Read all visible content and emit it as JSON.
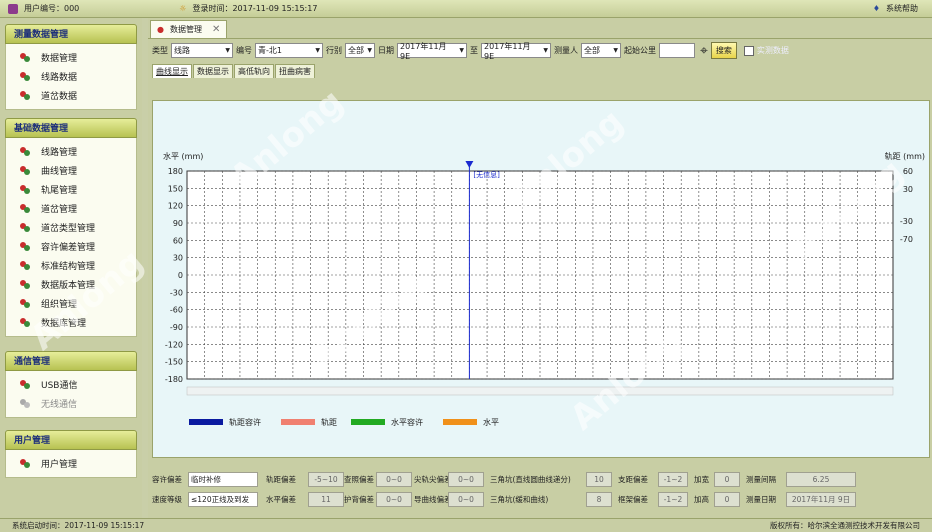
{
  "topbar": {
    "user_label": "用户编号：000",
    "login_label": "登录时间：2017-11-09 15:15:17",
    "help": "系统帮助"
  },
  "sidebar": {
    "groups": [
      {
        "title": "测量数据管理",
        "items": [
          "数据管理",
          "线路数据",
          "道岔数据"
        ]
      },
      {
        "title": "基础数据管理",
        "items": [
          "线路管理",
          "曲线管理",
          "轨尾管理",
          "道岔管理",
          "道岔类型管理",
          "容许偏差管理",
          "标准结构管理",
          "数据版本管理",
          "组织管理",
          "数据库管理"
        ]
      },
      {
        "title": "通信管理",
        "items": [
          "USB通信",
          "无线通信"
        ]
      },
      {
        "title": "用户管理",
        "items": [
          "用户管理"
        ]
      }
    ]
  },
  "main": {
    "tab_label": "数据管理",
    "filter": {
      "type_label": "类型",
      "type_value": "线路",
      "code_label": "编号",
      "code_value": "青-北1",
      "dir_label": "行别",
      "dir_value": "全部",
      "date_label": "日期",
      "date_from": "2017年11月 9E",
      "to_label": "至",
      "date_to": "2017年11月 9E",
      "person_label": "测量人",
      "person_value": "全部",
      "km_label": "起始公里",
      "search": "搜索",
      "realtime": "实测数据"
    },
    "subtabs": [
      "曲线显示",
      "数据显示",
      "高低轨向",
      "扭曲病害"
    ]
  },
  "chart_data": {
    "type": "line",
    "ylabel": "水平 (mm)",
    "y2label": "轨距 (mm)",
    "ylim": [
      -180,
      180
    ],
    "y_ticks": [
      180,
      150,
      120,
      90,
      60,
      30,
      0,
      -30,
      -60,
      -90,
      -120,
      -150,
      -180
    ],
    "y2_ticks": [
      "60",
      "30",
      "-30",
      "-70"
    ],
    "marker_label": "[无信息]",
    "legend": [
      {
        "name": "轨距容许",
        "color": "#0a1aa0"
      },
      {
        "name": "轨距",
        "color": "#f08070"
      },
      {
        "name": "水平容许",
        "color": "#22aa22"
      },
      {
        "name": "水平",
        "color": "#f0901a"
      }
    ]
  },
  "params": {
    "row1": [
      {
        "label": "容许偏差",
        "value": "临时补修"
      },
      {
        "label": "轨距偏差",
        "value": "-5~10"
      },
      {
        "label": "查照偏差",
        "value": "0~0"
      },
      {
        "label": "尖轨尖偏差",
        "value": "0~0"
      },
      {
        "label": "三角坑(直线圆曲线递分)",
        "value": "10"
      },
      {
        "label": "支距偏差",
        "value": "-1~2"
      },
      {
        "label": "加宽",
        "value": "0"
      },
      {
        "label": "测量间隔",
        "value": "6.25"
      }
    ],
    "row2": [
      {
        "label": "速度等级",
        "value": "≤120正线及到发"
      },
      {
        "label": "水平偏差",
        "value": "11"
      },
      {
        "label": "护背偏差",
        "value": "0~0"
      },
      {
        "label": "导曲线偏差",
        "value": "0~0"
      },
      {
        "label": "三角坑(缓和曲线)",
        "value": "8"
      },
      {
        "label": "框架偏差",
        "value": "-1~2"
      },
      {
        "label": "加高",
        "value": "0"
      },
      {
        "label": "测量日期",
        "value": "2017年11月 9日"
      }
    ]
  },
  "status": {
    "left": "系统启动时间：2017-11-09 15:15:17",
    "right": "版权所有：哈尔滨全通测控技术开发有限公司"
  }
}
